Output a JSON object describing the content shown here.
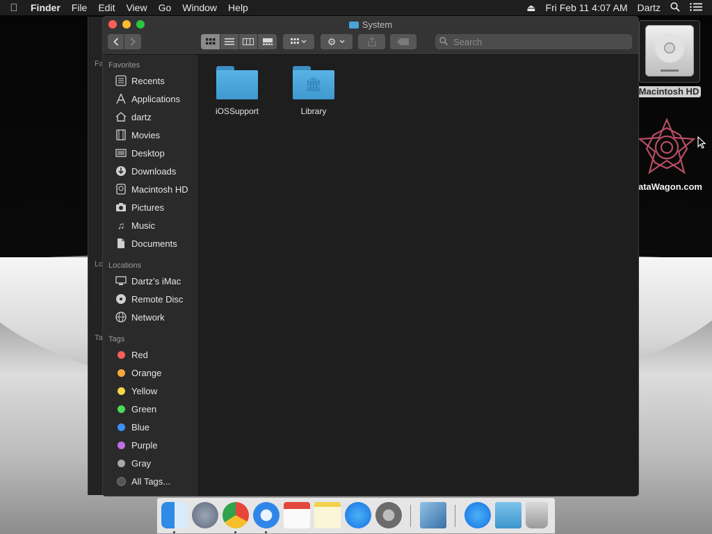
{
  "menubar": {
    "app": "Finder",
    "items": [
      "File",
      "Edit",
      "View",
      "Go",
      "Window",
      "Help"
    ],
    "datetime": "Fri Feb 11  4:07 AM",
    "user": "Dartz"
  },
  "window": {
    "title": "System",
    "search_placeholder": "Search"
  },
  "sidebar": {
    "favorites_label": "Favorites",
    "favorites": [
      "Recents",
      "Applications",
      "dartz",
      "Movies",
      "Desktop",
      "Downloads",
      "Macintosh HD",
      "Pictures",
      "Music",
      "Documents"
    ],
    "locations_label": "Locations",
    "locations": [
      "Dartz’s iMac",
      "Remote Disc",
      "Network"
    ],
    "tags_label": "Tags",
    "tags": [
      {
        "label": "Red",
        "color": "#fe5d5d"
      },
      {
        "label": "Orange",
        "color": "#f8a93a"
      },
      {
        "label": "Yellow",
        "color": "#f7d54a"
      },
      {
        "label": "Green",
        "color": "#4fd85a"
      },
      {
        "label": "Blue",
        "color": "#3d8ff5"
      },
      {
        "label": "Purple",
        "color": "#c06ee6"
      },
      {
        "label": "Gray",
        "color": "#a8a8a8"
      }
    ],
    "all_tags": "All Tags..."
  },
  "files": [
    {
      "name": "iOSSupport",
      "icon": "folder-icon"
    },
    {
      "name": "Library",
      "icon": "library-folder-icon"
    }
  ],
  "background_window_labels": [
    "Fa",
    "Lo",
    "Ta"
  ],
  "desktop": {
    "drive_label": "Macintosh HD",
    "datawagon_label": "ataWagon.com"
  }
}
